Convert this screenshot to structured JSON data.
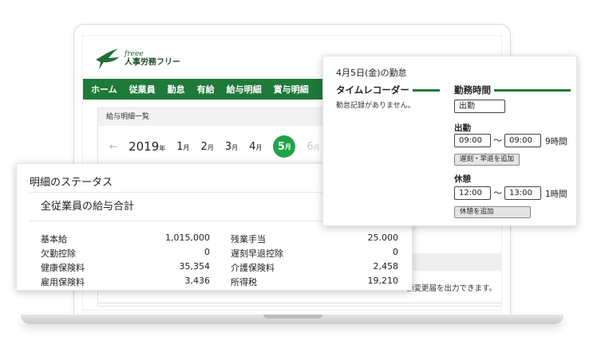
{
  "logo": {
    "small_text": "freee",
    "main_text": "人事労務フリー"
  },
  "nav": {
    "items": [
      "ホーム",
      "従業員",
      "勤怠",
      "有給",
      "給与明細",
      "賞与明細"
    ]
  },
  "payslip": {
    "header": "給与明細一覧",
    "arrow": "←",
    "year": "2019",
    "year_suffix": "年",
    "months": [
      {
        "num": "1",
        "suffix": "月"
      },
      {
        "num": "2",
        "suffix": "月"
      },
      {
        "num": "3",
        "suffix": "月"
      },
      {
        "num": "4",
        "suffix": "月"
      },
      {
        "num": "5",
        "suffix": "月"
      },
      {
        "num": "6",
        "suffix": "月"
      }
    ],
    "notice": "額変更届を出力できます。"
  },
  "status": {
    "title": "明細のステータス",
    "summary_title": "全従業員の給与合計",
    "rows_left": [
      {
        "label": "基本給",
        "value": "1,015,000"
      },
      {
        "label": "欠勤控除",
        "value": "0"
      },
      {
        "label": "健康保険料",
        "value": "35,354"
      },
      {
        "label": "雇用保険料",
        "value": "3,436"
      }
    ],
    "rows_right": [
      {
        "label": "残業手当",
        "value": "25.000"
      },
      {
        "label": "遅刻早退控除",
        "value": "0"
      },
      {
        "label": "介護保険料",
        "value": "2,458"
      },
      {
        "label": "所得税",
        "value": "19,210"
      }
    ]
  },
  "timecard": {
    "date": "4月5日(金)の勤怠",
    "recorder_title": "タイムレコーダー",
    "recorder_empty": "勤怠記録がありません。",
    "work_title": "勤務時間",
    "work_type": "出勤",
    "shift_label": "出勤",
    "shift_start": "09:00",
    "tilde": "〜",
    "shift_end": "09:00",
    "shift_hours": "9時間",
    "late_button": "遅刻・早退を追加",
    "break_label": "休憩",
    "break_start": "12:00",
    "break_end": "13:00",
    "break_hours": "1時間",
    "break_button": "休憩を追加"
  },
  "colors": {
    "brand_green": "#1f7a3a",
    "active_month": "#1fa34a"
  }
}
